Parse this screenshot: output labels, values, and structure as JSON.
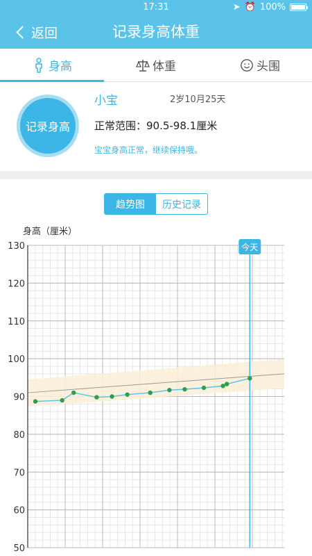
{
  "status_bar": {
    "time": "17:31",
    "battery": "100%"
  },
  "nav": {
    "back_label": "返回",
    "title": "记录身高体重"
  },
  "tabs": [
    {
      "label": "身高",
      "icon": "person-icon",
      "active": true
    },
    {
      "label": "体重",
      "icon": "scale-icon",
      "active": false
    },
    {
      "label": "头围",
      "icon": "face-icon",
      "active": false
    }
  ],
  "card": {
    "record_button": "记录身高",
    "name": "小宝",
    "age": "2岁10月25天",
    "normal_range": "正常范围：90.5-98.1厘米",
    "status_message": "宝宝身高正常，继续保持哦。"
  },
  "segments": [
    {
      "label": "趋势图",
      "active": true
    },
    {
      "label": "历史记录",
      "active": false
    }
  ],
  "colors": {
    "accent": "#3bb6e6",
    "point": "#2e9d4d",
    "band": "#fbeed6"
  },
  "chart_data": {
    "type": "line",
    "title": "",
    "ylabel": "身高（厘米）",
    "ylim": [
      50,
      130
    ],
    "yticks": [
      50,
      60,
      70,
      80,
      90,
      100,
      110,
      120,
      130
    ],
    "today_label": "今天",
    "today_x": 29,
    "xlim": [
      0,
      33.5
    ],
    "series": [
      {
        "x": [
          1,
          4.5,
          6,
          9,
          11,
          13,
          16,
          18.5,
          20.5,
          23,
          25.5,
          26,
          29
        ],
        "values": [
          88.7,
          89.0,
          91.0,
          89.8,
          90.0,
          90.5,
          91.0,
          91.7,
          91.9,
          92.3,
          92.8,
          93.3,
          94.8
        ]
      }
    ],
    "normal_band": {
      "lower": [
        87.3,
        92.2
      ],
      "upper": [
        94.5,
        99.9
      ]
    },
    "median_line": [
      91.0,
      96.0
    ],
    "grid": true
  }
}
